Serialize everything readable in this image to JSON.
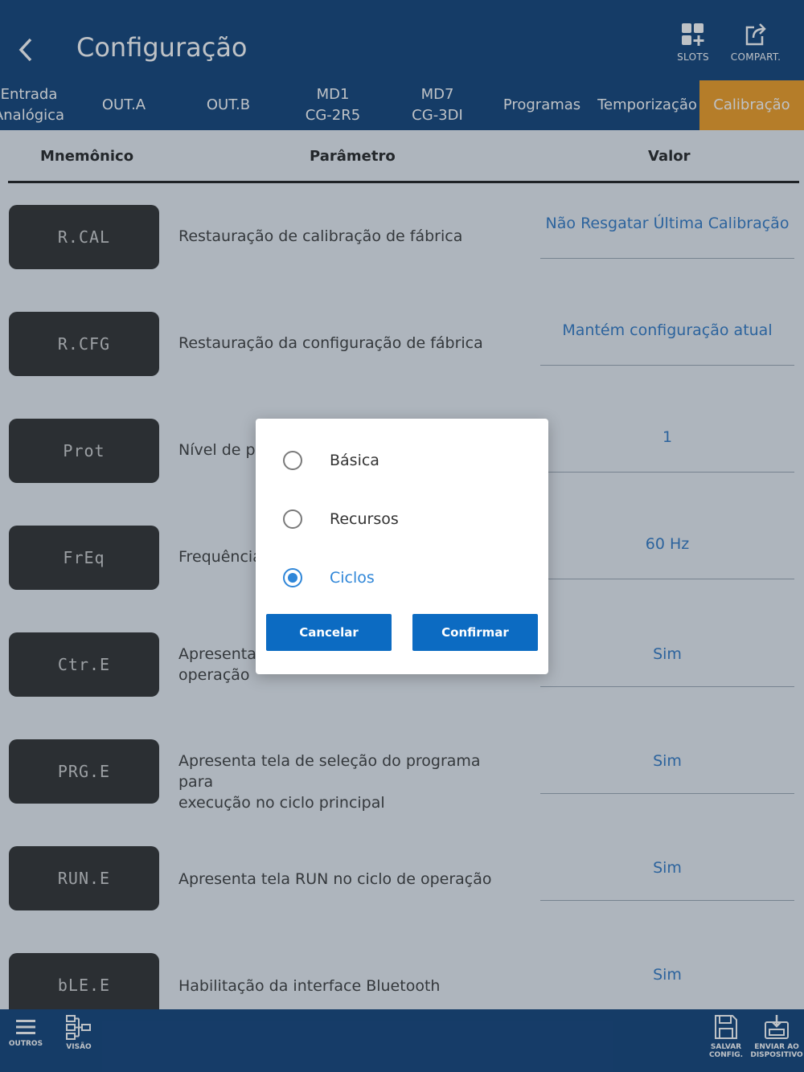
{
  "header": {
    "title": "Configuração",
    "slots_label": "SLOTS",
    "share_label": "COMPART."
  },
  "tabs": [
    {
      "label": "Entrada\nAnalógica"
    },
    {
      "label": "OUT.A"
    },
    {
      "label": "OUT.B"
    },
    {
      "label": "MD1\nCG-2R5"
    },
    {
      "label": "MD7\nCG-3DI"
    },
    {
      "label": "Programas"
    },
    {
      "label": "Temporização"
    },
    {
      "label": "Calibração",
      "active": true
    }
  ],
  "table": {
    "headers": {
      "mnemonic": "Mnemônico",
      "parameter": "Parâmetro",
      "value": "Valor"
    },
    "rows": [
      {
        "mnemonic": "R.CAL",
        "parameter": "Restauração de calibração de fábrica",
        "value": "Não Resgatar Última Calibração"
      },
      {
        "mnemonic": "R.CFG",
        "parameter": "Restauração da configuração de fábrica",
        "value": "Mantém configuração atual"
      },
      {
        "mnemonic": "Prot",
        "parameter": "Nível de pr",
        "value": "1"
      },
      {
        "mnemonic": "FrEq",
        "parameter": "Frequência",
        "value": "60 Hz"
      },
      {
        "mnemonic": "Ctr.E",
        "parameter": "Apresenta\noperação",
        "value": "Sim"
      },
      {
        "mnemonic": "PRG.E",
        "parameter": "Apresenta tela de seleção do programa para\nexecução no ciclo principal",
        "value": "Sim"
      },
      {
        "mnemonic": "RUN.E",
        "parameter": "Apresenta tela RUN no ciclo de operação",
        "value": "Sim"
      },
      {
        "mnemonic": "bLE.E",
        "parameter": "Habilitação da interface Bluetooth",
        "value": "Sim"
      }
    ]
  },
  "dialog": {
    "options": [
      {
        "label": "Básica",
        "selected": false
      },
      {
        "label": "Recursos",
        "selected": false
      },
      {
        "label": "Ciclos",
        "selected": true
      }
    ],
    "cancel_label": "Cancelar",
    "confirm_label": "Confirmar"
  },
  "bottom_bar": {
    "others_label": "OUTROS",
    "view_label": "VISÃO",
    "save_label": "SALVAR\nCONFIG.",
    "send_label": "ENVIAR AO\nDISPOSITIVO"
  },
  "colors": {
    "primary": "#0e3f78",
    "active_tab": "#f39c1f",
    "value_text": "#2f78c4",
    "button": "#0c6bc2",
    "radio_selected": "#2f86d8"
  },
  "icons": [
    "back-arrow-icon",
    "slots-icon",
    "share-icon",
    "menu-icon",
    "view-tree-icon",
    "save-icon",
    "send-to-device-icon"
  ]
}
